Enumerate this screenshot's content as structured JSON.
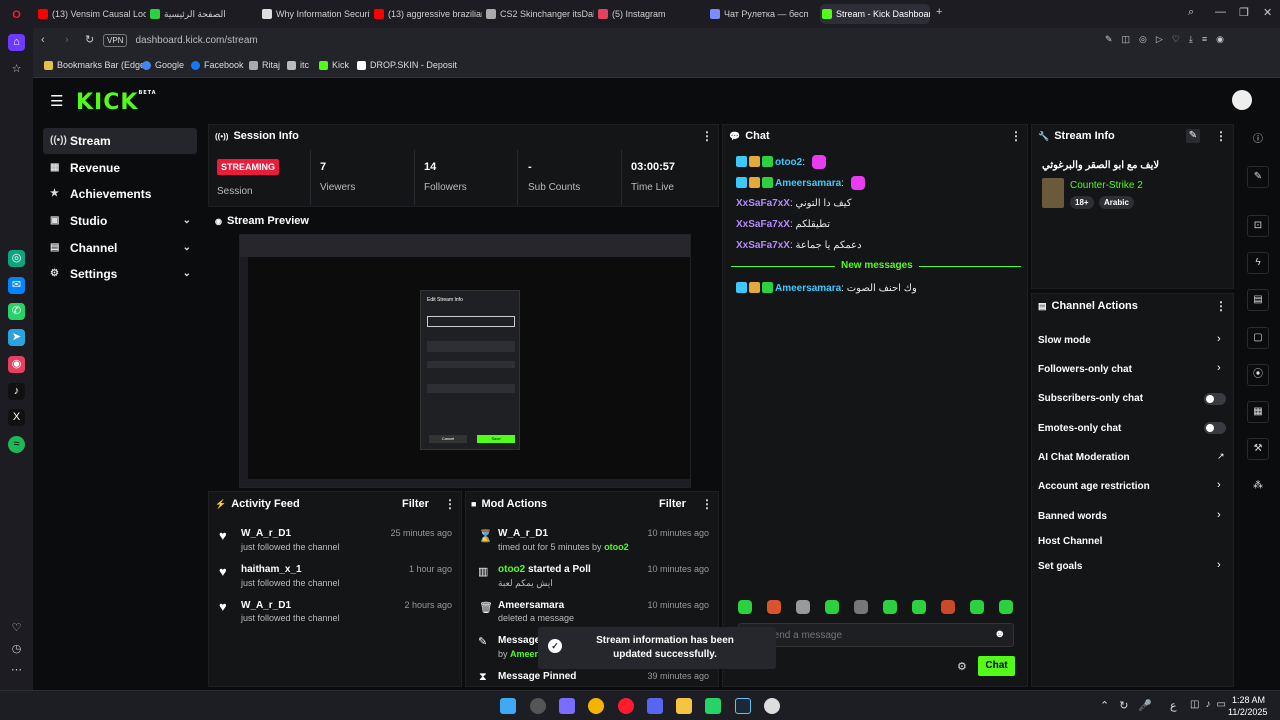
{
  "browser": {
    "tabs": [
      {
        "label": "(13) Vensim Causal Loop [",
        "color": "#ff0000"
      },
      {
        "label": "الصفحة الرئيسية",
        "color": "#2bd13f"
      },
      {
        "label": "Why Information Security",
        "color": "#dddddd"
      },
      {
        "label": "(13) aggressive brazilian p",
        "color": "#ff0000"
      },
      {
        "label": "CS2 Skinchanger itsDaBoR",
        "color": "#aaaaaa"
      },
      {
        "label": "(5) Instagram",
        "color": "#e4405f"
      },
      {
        "label": "Чат Рулетка — бесп",
        "color": "#7a8cff"
      },
      {
        "label": "Stream - Kick Dashboard",
        "color": "#53fc18"
      }
    ],
    "url": "dashboard.kick.com/stream",
    "vpn_label": "VPN",
    "bookmarks": [
      {
        "label": "Bookmarks Bar (Edge)",
        "color": "#e5c14a"
      },
      {
        "label": "Google",
        "color": "#4285f4"
      },
      {
        "label": "Facebook",
        "color": "#1877f2"
      },
      {
        "label": "Ritaj",
        "color": "#aaaaaa"
      },
      {
        "label": "itc",
        "color": "#bbbbbb"
      },
      {
        "label": "Kick",
        "color": "#53fc18"
      },
      {
        "label": "DROP.SKIN - Deposit",
        "color": "#ffffff"
      }
    ]
  },
  "kick": {
    "logo": "KICK",
    "logo_beta": "BETA",
    "nav": [
      "Stream",
      "Revenue",
      "Achievements",
      "Studio",
      "Channel",
      "Settings"
    ],
    "session_info": {
      "title": "Session Info",
      "status_badge": "STREAMING",
      "session_label": "Session",
      "viewers_value": "7",
      "viewers_label": "Viewers",
      "followers_value": "14",
      "followers_label": "Followers",
      "subs_value": "-",
      "subs_label": "Sub Counts",
      "time_value": "03:00:57",
      "time_label": "Time Live"
    },
    "preview": {
      "title": "Stream Preview",
      "dialog_title": "Edit Stream Info",
      "cancel": "Cancel",
      "save": "Save"
    },
    "activity_feed": {
      "title": "Activity Feed",
      "filter": "Filter",
      "items": [
        {
          "name": "W_A_r_D1",
          "sub": "just followed the channel",
          "time": "25 minutes ago"
        },
        {
          "name": "haitham_x_1",
          "sub": "just followed the channel",
          "time": "1 hour ago"
        },
        {
          "name": "W_A_r_D1",
          "sub": "just followed the channel",
          "time": "2 hours ago"
        }
      ]
    },
    "mod_actions": {
      "title": "Mod Actions",
      "filter": "Filter",
      "items": [
        {
          "name": "W_A_r_D1",
          "sub": "timed out for 5 minutes by",
          "by": "otoo2",
          "time": "10 minutes ago"
        },
        {
          "name": "otoo2",
          "name_suffix": "started a Poll",
          "sub": "ايش يمكم لعبة",
          "time": "10 minutes ago"
        },
        {
          "name": "Ameersamara",
          "sub": "deleted a message",
          "time": "10 minutes ago"
        },
        {
          "name": "Message",
          "sub": "by",
          "by": "Ameers",
          "time": ""
        },
        {
          "name": "Message Pinned",
          "sub": "",
          "time": "39 minutes ago"
        }
      ]
    },
    "chat": {
      "title": "Chat",
      "messages": [
        {
          "user": "otoo2",
          "text": "",
          "style": "blue",
          "badges": true
        },
        {
          "user": "Ameersamara",
          "text": "",
          "style": "blue",
          "badges": true
        },
        {
          "user": "XxSaFa7xX",
          "text": "كيف دا التوني",
          "style": "purple",
          "badges": false
        },
        {
          "user": "XxSaFa7xX",
          "text": "تطيقلكم",
          "style": "purple",
          "badges": false
        },
        {
          "user": "XxSaFa7xX",
          "text": "دعمكم يا جماعة",
          "style": "purple",
          "badges": false
        }
      ],
      "new_messages_label": "New messages",
      "after_new": {
        "user": "Ameersamara",
        "text": "وك احنف الصوت",
        "style": "blue"
      },
      "input_placeholder": "Send a message",
      "send_button": "Chat"
    },
    "stream_info": {
      "title": "Stream Info",
      "stream_title": "لايف مع ابو الصقر والبرغوثي",
      "category": "Counter-Strike 2",
      "tags": [
        "18+",
        "Arabic"
      ]
    },
    "channel_actions": {
      "title": "Channel Actions",
      "items": [
        {
          "label": "Slow mode",
          "control": "chevron"
        },
        {
          "label": "Followers-only chat",
          "control": "chevron"
        },
        {
          "label": "Subscribers-only chat",
          "control": "toggle"
        },
        {
          "label": "Emotes-only chat",
          "control": "toggle"
        },
        {
          "label": "AI Chat Moderation",
          "control": "external"
        },
        {
          "label": "Account age restriction",
          "control": "chevron"
        },
        {
          "label": "Banned words",
          "control": "chevron"
        },
        {
          "label": "Host Channel",
          "control": "none"
        },
        {
          "label": "Set goals",
          "control": "chevron"
        }
      ]
    },
    "toast": "Stream information has been updated successfully."
  },
  "taskbar": {
    "time": "1:28 AM",
    "date": "11/2/2025",
    "lang": "ع"
  },
  "colors": {
    "brand": "#53fc18",
    "live": "#e91d3b",
    "panel": "#141517"
  }
}
